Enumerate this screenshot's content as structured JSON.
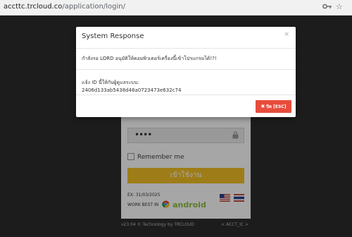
{
  "browser": {
    "url_host": "accttc.trcloud.co",
    "url_path": "/application/login/"
  },
  "login": {
    "password_value": "••••",
    "remember_label": "Remember me",
    "login_button_label": "เข้าใช้งาน",
    "expiry_text": "EX: 31/03/2025",
    "work_best_text": "WORK BEST IN",
    "android_text": "android",
    "version_text": "v23.04 © Technology by TRCLOUD",
    "acct_link": "< ACCT_IC >"
  },
  "modal": {
    "title": "System Response",
    "close_symbol": "×",
    "message": "กำลังรอ LORD อนุมัติให้คอมพิวเตอร์เครื่องนี้เข้าโปรแกรมได้!?!",
    "info_line1": "แจ้ง ID นี้ให้กับผู้ดูแลระบบ:",
    "info_line2": "2406d133ab5438d46a0723473e632c74",
    "close_button_label": "ปิด [ESC]"
  },
  "colors": {
    "accent_yellow": "#f3c025",
    "close_red": "#e74c3c",
    "android_green": "#8fbf3f"
  }
}
